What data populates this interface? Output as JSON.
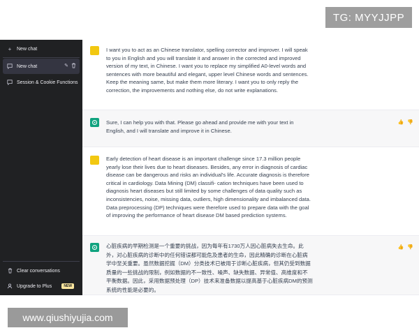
{
  "watermarks": {
    "top_right": "TG: MYYJJPP",
    "bottom_left": "www.qiushiyujia.com"
  },
  "sidebar": {
    "new_chat_button": "New chat",
    "conversations": [
      {
        "label": "New chat",
        "active": true
      },
      {
        "label": "Session & Cookie Functions",
        "active": false
      }
    ],
    "clear_label": "Clear conversations",
    "upgrade_label": "Upgrade to Plus",
    "new_badge": "NEW"
  },
  "messages": [
    {
      "role": "user",
      "text": "I want you to act as an Chinese translator, spelling corrector and improver. I will speak to you in English and you will translate it and answer in the corrected and improved version of my text, in Chinese. I want you to replace my simplified A0-level words and sentences with more beautiful and elegant, upper level Chinese words and sentences. Keep the meaning same, but make them more literary. I want you to only reply the correction, the improvements and nothing else, do not write explanations."
    },
    {
      "role": "assistant",
      "text": "Sure, I can help you with that. Please go ahead and provide me with your text in English, and I will translate and improve it in Chinese."
    },
    {
      "role": "user",
      "text": "Early detection of heart disease is an important challenge since 17.3 million people yearly lose their lives due to heart diseases. Besides, any error in diagnosis of cardiac disease can be dangerous and risks an individual's life. Accurate diagnosis is therefore critical in cardiology. Data Mining (DM) classifi- cation techniques have been used to diagnosis heart diseases but still limited by some challenges of data quality such as inconsistencies, noise, missing data, outliers, high dimensionality and imbalanced data. Data preprocessing (DP) techniques were therefore used to prepare data with the goal of improving the performance of heart disease DM based prediction systems."
    },
    {
      "role": "assistant",
      "text": "心脏疾病的早期检测是一个重要的挑战，因为每年有1730万人因心脏病失去生命。此外，对心脏疾病的诊断中的任何错误都可能危及患者的生命，因此精确的诊断在心脏病学中至关重要。虽然数据挖掘（DM）分类技术已被用于诊断心脏疾病，但其仍受到数据质量的一些挑战的限制，例如数据的不一致性、噪声、缺失数据、异常值、高维度和不平衡数据。因此，采用数据预处理（DP）技术来准备数据以提高基于心脏疾病DM的预测系统的性能是必要的。"
    }
  ]
}
